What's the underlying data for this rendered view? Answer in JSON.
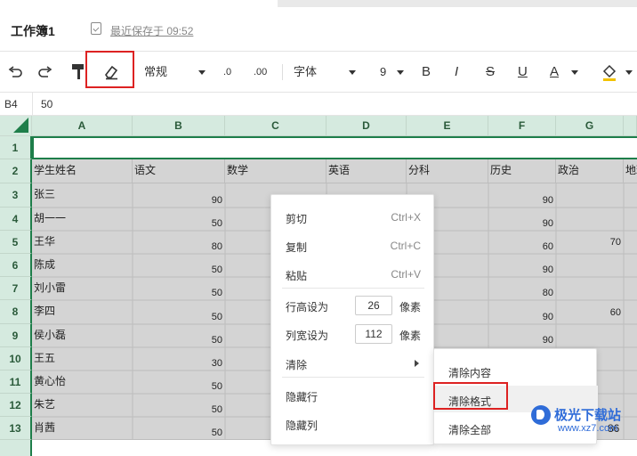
{
  "titlebar": {
    "workbook_title": "工作簿1",
    "save_status": "最近保存于 09:52",
    "save_icon": "document-check-icon"
  },
  "toolbar": {
    "undo_icon": "undo-icon",
    "redo_icon": "redo-icon",
    "format_painter_icon": "format-painter-icon",
    "eraser_icon": "eraser-icon",
    "number_format": "常规",
    "decrease_decimal": ".0",
    "increase_decimal": ".00",
    "font_family": "字体",
    "font_size": "9",
    "bold": "B",
    "italic": "I",
    "strikethrough": "S",
    "underline": "U",
    "font_color": "A",
    "fill_icon": "fill-bucket-icon",
    "highlight_color": "#d22222"
  },
  "formula_bar": {
    "cell_ref": "B4",
    "value": "50"
  },
  "sheet": {
    "columns": [
      "A",
      "B",
      "C",
      "D",
      "E",
      "F",
      "G"
    ],
    "rows": [
      "1",
      "2",
      "3",
      "4",
      "5",
      "6",
      "7",
      "8",
      "9",
      "10",
      "11",
      "12",
      "13"
    ],
    "headers": [
      "学生姓名",
      "语文",
      "数学",
      "英语",
      "分科",
      "历史",
      "政治",
      "地理"
    ],
    "names": [
      "张三",
      "胡一一",
      "王华",
      "陈成",
      "刘小雷",
      "李四",
      "侯小磊",
      "王五",
      "黄心怡",
      "朱艺",
      "肖茜"
    ],
    "chinese": [
      "90",
      "50",
      "80",
      "50",
      "50",
      "50",
      "50",
      "30",
      "50",
      "50",
      "50"
    ],
    "history": [
      "90",
      "90",
      "60",
      "90",
      "80",
      "90",
      "90"
    ],
    "politics_row5": "70",
    "politics_row8": "60",
    "stray_value": "86"
  },
  "context_menu": {
    "cut": "剪切",
    "cut_shortcut": "Ctrl+X",
    "copy": "复制",
    "copy_shortcut": "Ctrl+C",
    "paste": "粘贴",
    "paste_shortcut": "Ctrl+V",
    "row_height_label": "行高设为",
    "row_height_value": "26",
    "col_width_label": "列宽设为",
    "col_width_value": "112",
    "unit": "像素",
    "clear": "清除",
    "hide_row": "隐藏行",
    "hide_col": "隐藏列"
  },
  "submenu": {
    "clear_content": "清除内容",
    "clear_format": "清除格式",
    "clear_all": "清除全部"
  },
  "watermark": {
    "text": "极光下载站",
    "url": "www.xz7.com"
  }
}
